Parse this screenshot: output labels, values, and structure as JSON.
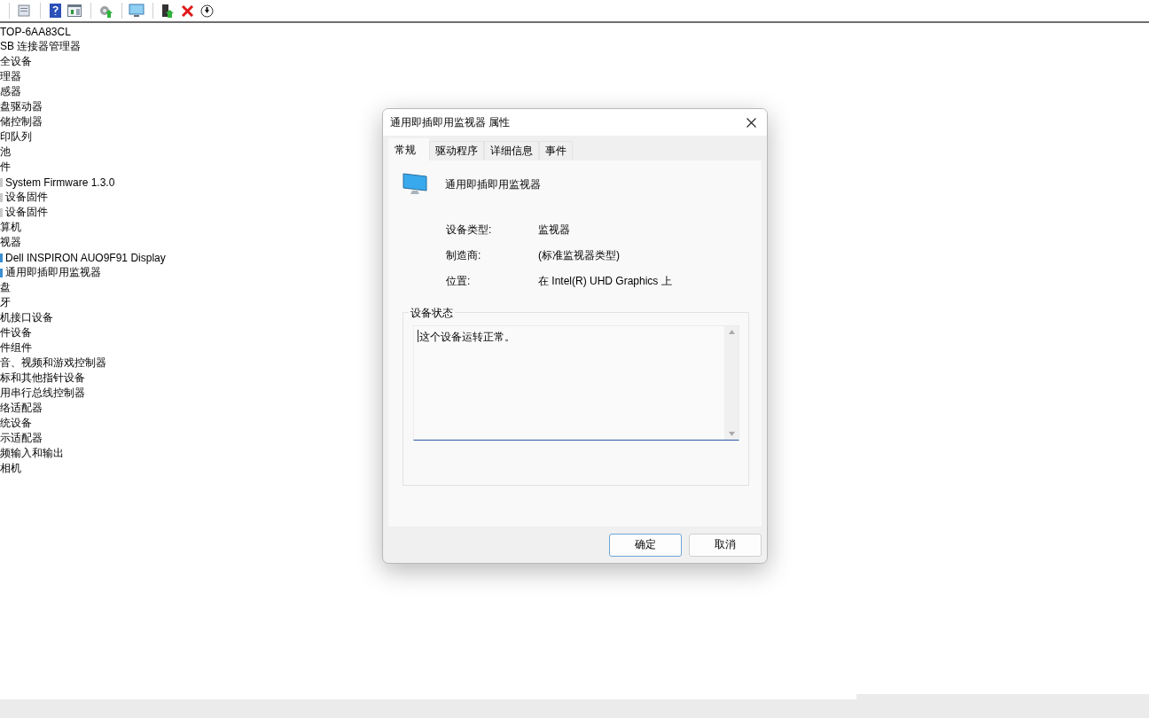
{
  "toolbar": {
    "buttons": [
      {
        "kind": "properties"
      },
      {
        "kind": "help"
      },
      {
        "kind": "view"
      },
      {
        "kind": "scan"
      },
      {
        "kind": "monitor"
      },
      {
        "kind": "update"
      },
      {
        "kind": "remove"
      },
      {
        "kind": "down"
      }
    ]
  },
  "tree": {
    "items": [
      {
        "label": "TOP-6AA83CL"
      },
      {
        "label": "SB 连接器管理器"
      },
      {
        "label": "全设备"
      },
      {
        "label": "理器"
      },
      {
        "label": "感器"
      },
      {
        "label": "盘驱动器"
      },
      {
        "label": "储控制器"
      },
      {
        "label": "印队列"
      },
      {
        "label": "池"
      },
      {
        "label": "件",
        "children": [
          {
            "label": "System Firmware 1.3.0"
          },
          {
            "label": "设备固件"
          },
          {
            "label": "设备固件"
          }
        ]
      },
      {
        "label": "算机"
      },
      {
        "label": "视器",
        "children": [
          {
            "label": "Dell INSPIRON AUO9F91 Display"
          },
          {
            "label": "通用即插即用监视器"
          }
        ]
      },
      {
        "label": "盘"
      },
      {
        "label": "牙"
      },
      {
        "label": "机接口设备"
      },
      {
        "label": "件设备"
      },
      {
        "label": "件组件"
      },
      {
        "label": "音、视频和游戏控制器"
      },
      {
        "label": "标和其他指针设备"
      },
      {
        "label": "用串行总线控制器"
      },
      {
        "label": "络适配器"
      },
      {
        "label": "统设备"
      },
      {
        "label": "示适配器"
      },
      {
        "label": "频输入和输出"
      },
      {
        "label": "相机"
      }
    ]
  },
  "dialog": {
    "title": "通用即插即用监视器 属性",
    "tabs": [
      {
        "label": "常规",
        "selected": true
      },
      {
        "label": "驱动程序",
        "selected": false
      },
      {
        "label": "详细信息",
        "selected": false
      },
      {
        "label": "事件",
        "selected": false
      }
    ],
    "device_name": "通用即插即用监视器",
    "properties": [
      {
        "label": "设备类型:",
        "value": "监视器"
      },
      {
        "label": "制造商:",
        "value": "(标准监视器类型)"
      },
      {
        "label": "位置:",
        "value": "在 Intel(R) UHD Graphics 上"
      }
    ],
    "status_group": {
      "title": "设备状态",
      "text": "这个设备运转正常。"
    },
    "buttons": [
      {
        "label": "确定",
        "default": true
      },
      {
        "label": "取消",
        "default": false
      }
    ]
  }
}
